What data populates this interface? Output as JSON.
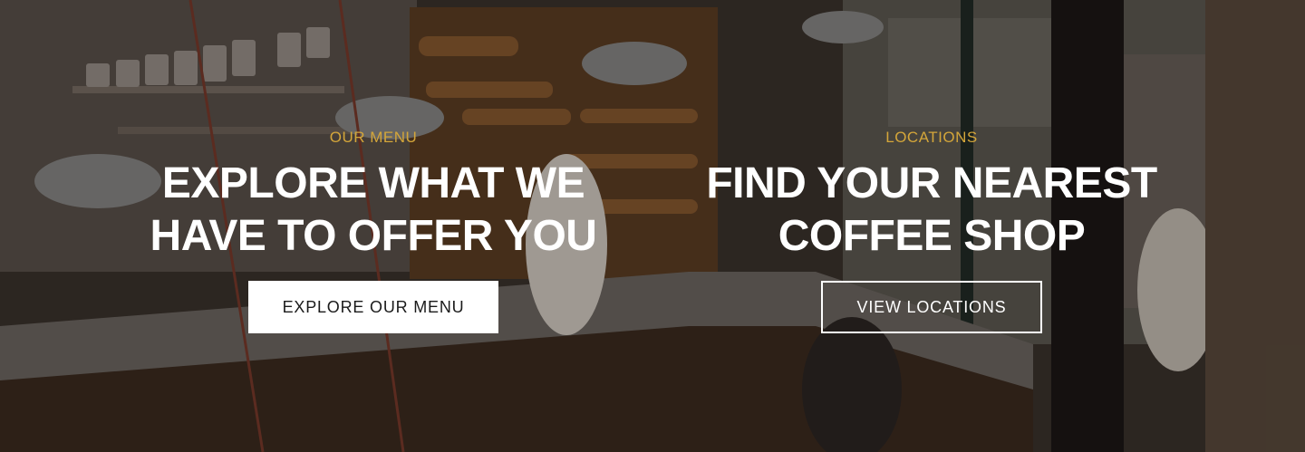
{
  "colors": {
    "accent": "#d4a63a",
    "text_light": "#ffffff",
    "button_bg": "#ffffff",
    "button_text": "#1a1a1a"
  },
  "menu_section": {
    "eyebrow": "OUR MENU",
    "headline_line1": "EXPLORE WHAT WE",
    "headline_line2": "HAVE TO OFFER YOU",
    "button_label": "EXPLORE OUR MENU"
  },
  "locations_section": {
    "eyebrow": "LOCATIONS",
    "headline_line1": "FIND YOUR NEAREST",
    "headline_line2": "COFFEE SHOP",
    "button_label": "VIEW LOCATIONS"
  }
}
